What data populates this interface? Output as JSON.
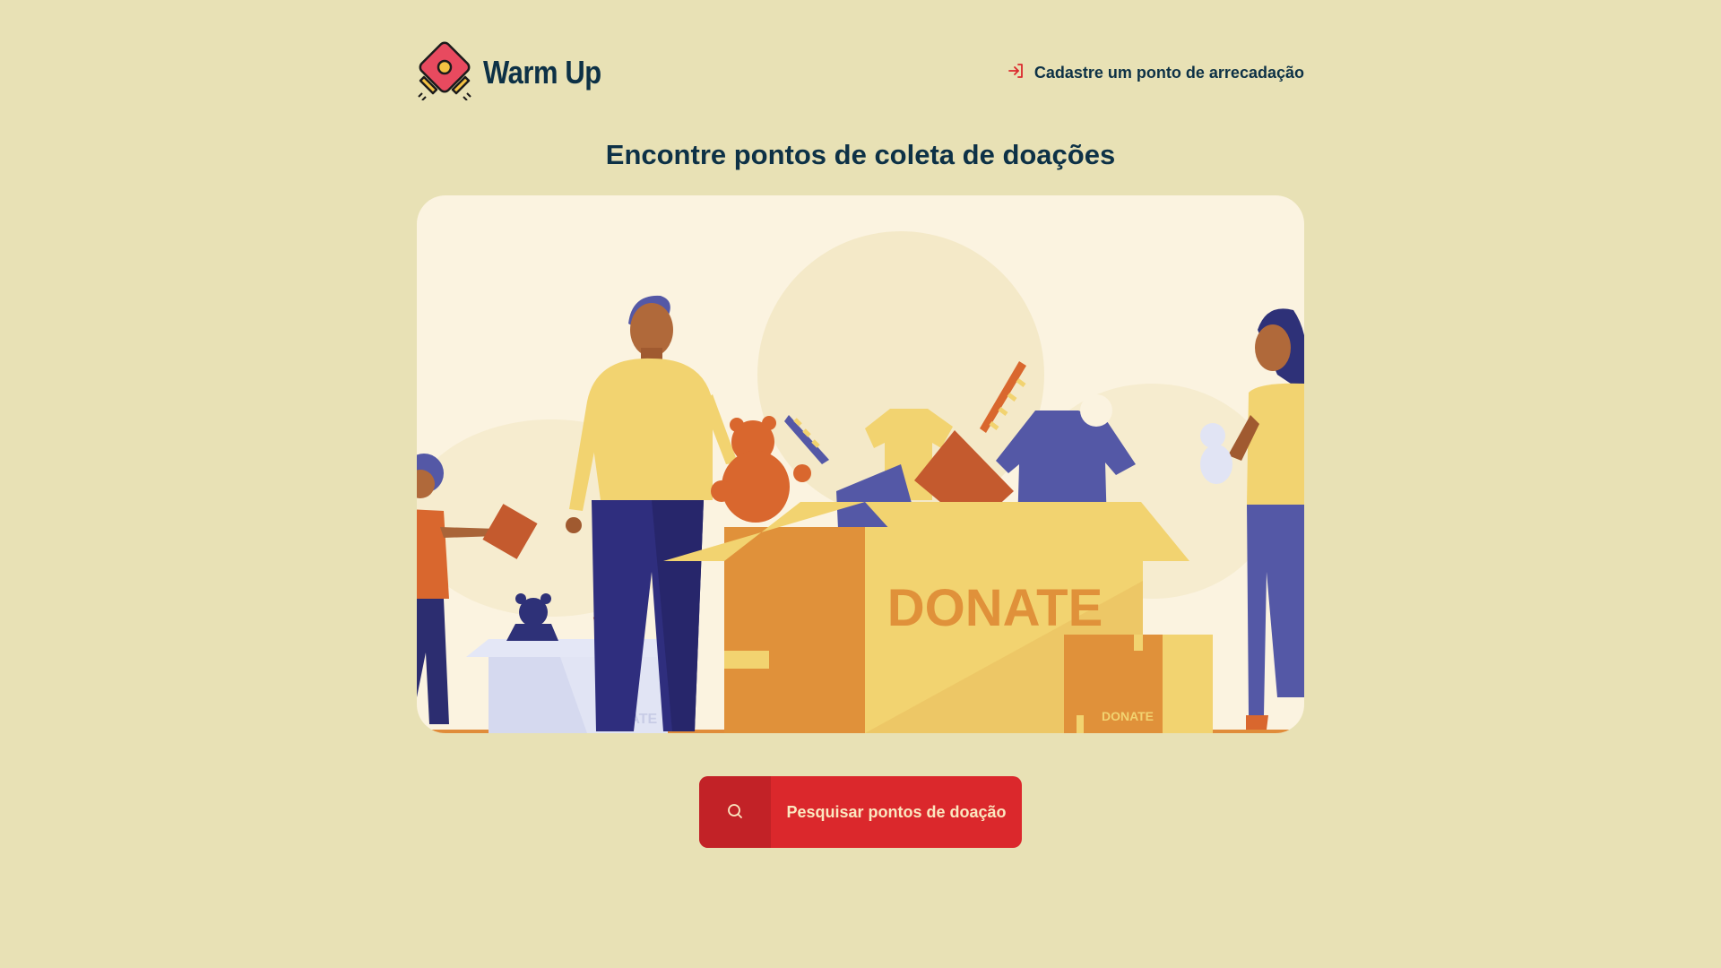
{
  "header": {
    "app_name": "Warm Up",
    "register_link_label": "Cadastre um ponto de arrecadação"
  },
  "main": {
    "title": "Encontre pontos de coleta de doações",
    "illustration": {
      "box_large_text": "DONATE",
      "box_small_text": "DONATE",
      "box_white_text": "DONATE"
    },
    "search_button_label": "Pesquisar pontos de doação"
  },
  "colors": {
    "background": "#E8E1B5",
    "primary_text": "#0D3146",
    "accent_red": "#DB282C",
    "accent_red_dark": "#C22227"
  },
  "icons": {
    "logo": "scarf-logo-icon",
    "register": "sign-in-icon",
    "search": "search-icon"
  }
}
